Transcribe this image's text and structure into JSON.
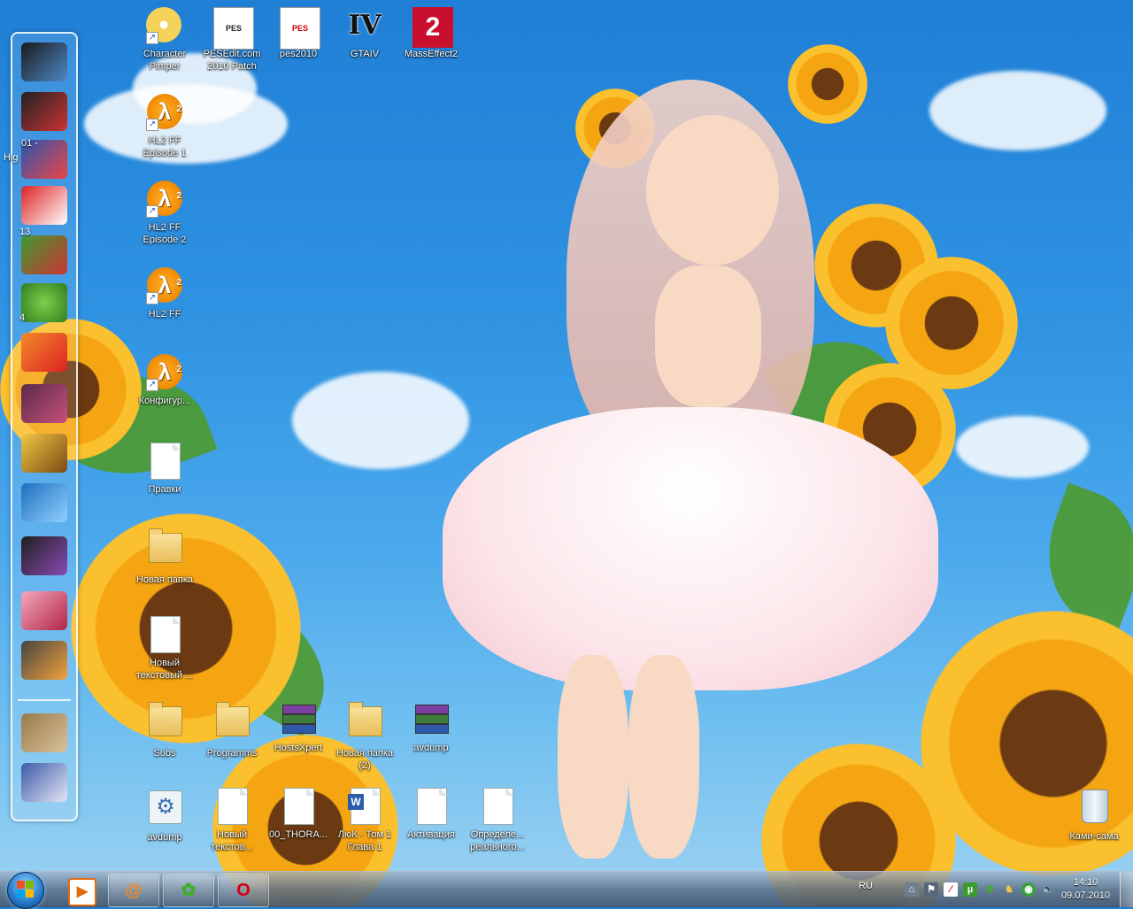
{
  "desktop": {
    "icons": [
      {
        "label": "Character Pimper",
        "icon": "disc-setup-icon"
      },
      {
        "label": "PESEdit.com 2010 Patch",
        "icon": "pes-patch-icon"
      },
      {
        "label": "pes2010",
        "icon": "pes2010-icon"
      },
      {
        "label": "GTAIV",
        "icon": "gtaiv-icon"
      },
      {
        "label": "MassEffect2",
        "icon": "masseffect2-icon"
      },
      {
        "label": "HL2 FF Episode 1",
        "icon": "half-life-icon"
      },
      {
        "label": "HL2 FF Episode 2",
        "icon": "half-life-icon"
      },
      {
        "label": "HL2 FF",
        "icon": "half-life-icon"
      },
      {
        "label": "Конфигур...",
        "icon": "half-life-icon"
      },
      {
        "label": "Правки",
        "icon": "text-document-icon"
      },
      {
        "label": "Новая папка",
        "icon": "folder-icon"
      },
      {
        "label": "Новый текстовый ...",
        "icon": "text-document-icon"
      },
      {
        "label": "Subs",
        "icon": "folder-icon"
      },
      {
        "label": "Programms",
        "icon": "folder-icon"
      },
      {
        "label": "HostsXpert",
        "icon": "winrar-icon"
      },
      {
        "label": "Новая папка (2)",
        "icon": "folder-icon"
      },
      {
        "label": "avdump",
        "icon": "winrar-icon"
      },
      {
        "label": "avdump",
        "icon": "settings-file-icon"
      },
      {
        "label": "Новый текстов...",
        "icon": "text-document-icon"
      },
      {
        "label": "00_THORA...",
        "icon": "text-document-icon"
      },
      {
        "label": "ЛюК - Том 1 Глава 1",
        "icon": "word-document-icon"
      },
      {
        "label": "Активация",
        "icon": "text-document-icon"
      },
      {
        "label": "Определе... реального...",
        "icon": "text-document-icon"
      },
      {
        "label": "Ками-сама",
        "icon": "recycle-bin-icon"
      }
    ]
  },
  "dock": {
    "partial_labels": [
      "01 -",
      "Hig",
      "13",
      "4"
    ]
  },
  "taskbar": {
    "start_label": "Start",
    "pinned": [
      {
        "name": "media-player-icon",
        "glyph": "▶"
      },
      {
        "name": "mail-agent-icon",
        "glyph": "@"
      },
      {
        "name": "icq-icon",
        "glyph": "✿"
      },
      {
        "name": "opera-icon",
        "glyph": "O"
      }
    ],
    "language": "RU",
    "time": "14:10",
    "date": "09.07.2010"
  }
}
